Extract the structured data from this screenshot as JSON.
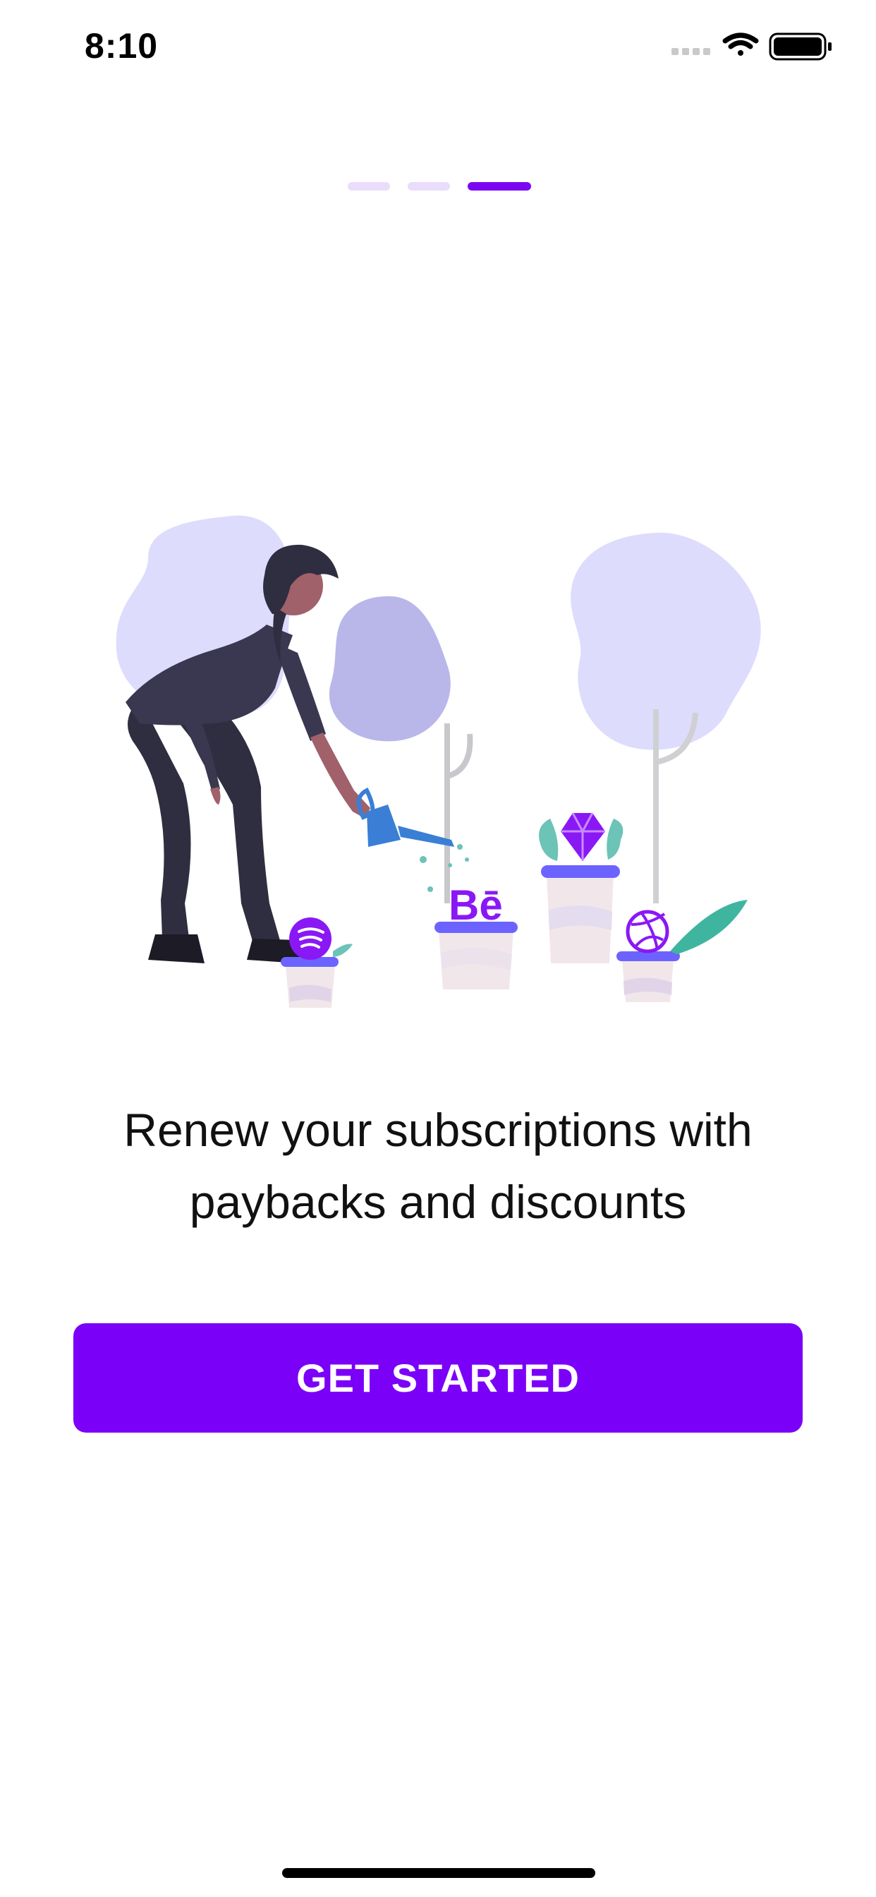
{
  "status_bar": {
    "time": "8:10",
    "icons": [
      "cellular-signal-icon",
      "wifi-icon",
      "battery-icon"
    ]
  },
  "pager": {
    "page_count": 3,
    "active_index": 2,
    "colors": {
      "inactive": "#eadcfb",
      "active": "#7b07f2"
    }
  },
  "illustration": {
    "name": "woman-watering-plants-illustration",
    "icons": [
      "spotify-icon",
      "behance-icon",
      "sketch-gem-icon",
      "dribbble-icon"
    ],
    "behance_text": "Bē",
    "colors": {
      "accent": "#8a18f5",
      "tree_light": "#dedcfd",
      "tree_mid": "#b9b7e9",
      "pot": "#f1e7ea"
    }
  },
  "onboarding": {
    "headline_line1": "Renew your subscriptions with",
    "headline_line2": "paybacks and discounts"
  },
  "cta": {
    "label": "GET STARTED",
    "color": "#7b00f7"
  }
}
